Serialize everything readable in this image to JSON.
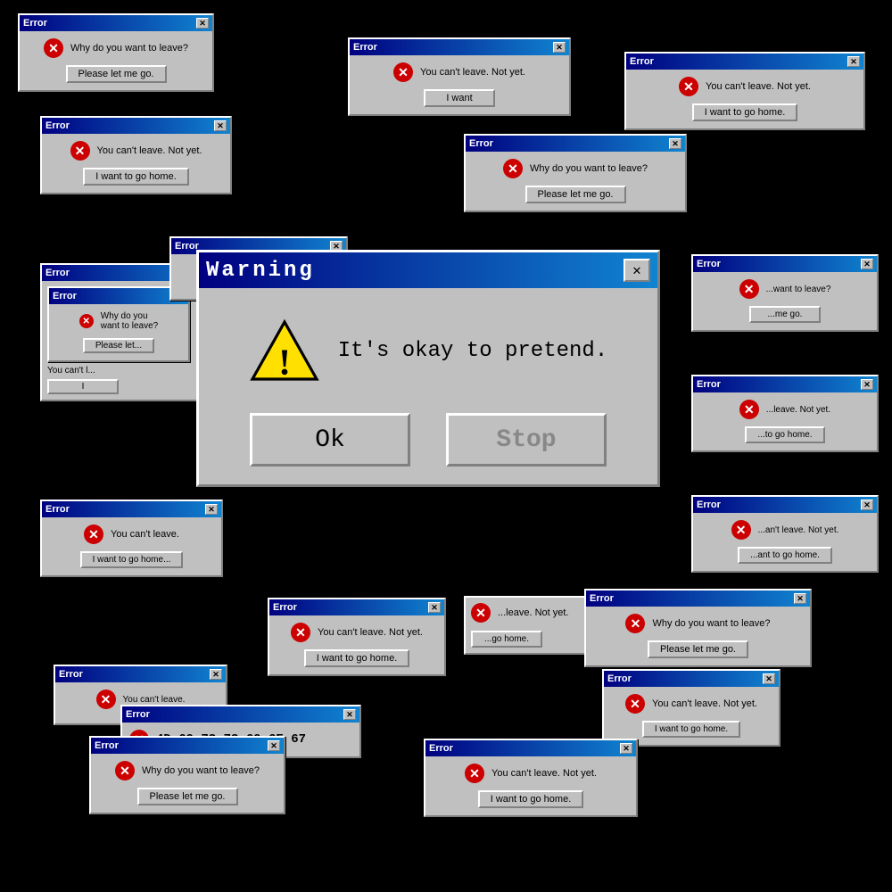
{
  "dialogs": {
    "error_label": "Error",
    "warning_label": "Warning",
    "messages": {
      "why_leave": "Why do you want to leave?",
      "cant_leave": "You can't leave. Not yet.",
      "main_message": "It's okay to pretend.",
      "hex_message": "4D 69 73 73 69 6E 67"
    },
    "buttons": {
      "please_let_me_go": "Please let me go.",
      "i_want_to_go_home": "I want to go home.",
      "ok": "Ok",
      "stop": "Stop",
      "i_want": "I want"
    },
    "close_x": "✕",
    "warning_close": "✕"
  }
}
